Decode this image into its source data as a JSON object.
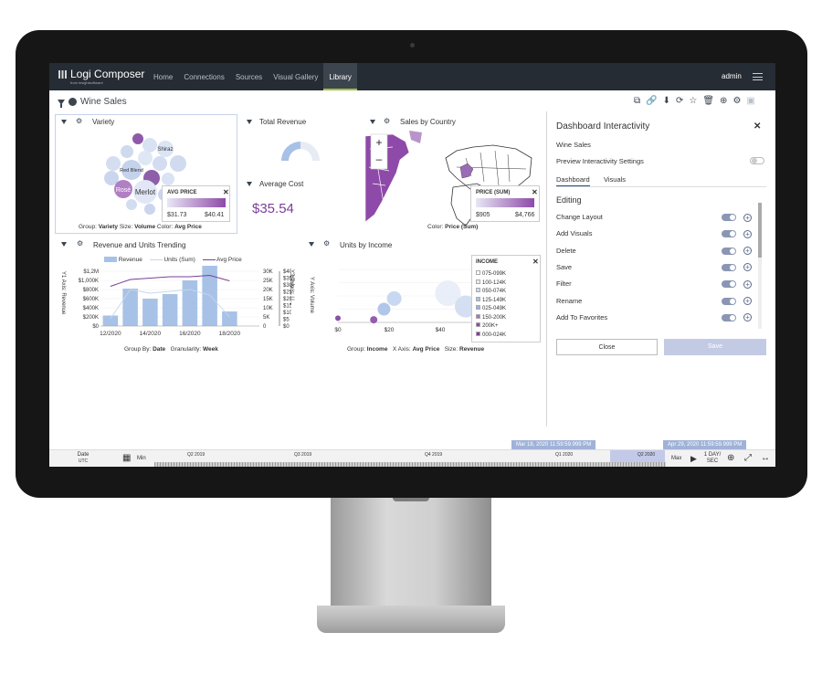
{
  "app": {
    "logo_name": "Logi Composer",
    "logo_sub": "from insightsoftware",
    "nav": [
      "Home",
      "Connections",
      "Sources",
      "Visual Gallery",
      "Library"
    ],
    "active_nav": "Library",
    "user": "admin"
  },
  "dashboard": {
    "title": "Wine Sales"
  },
  "variety": {
    "title": "Variety",
    "bubbles": [
      {
        "label": "Shiraz"
      },
      {
        "label": "Red Blend"
      },
      {
        "label": "Merlot"
      },
      {
        "label": "Rosé"
      }
    ],
    "legend_title": "AVG PRICE",
    "legend_min": "$31.73",
    "legend_max": "$40.41",
    "footer": {
      "group_label": "Group:",
      "group_value": "Variety",
      "size_label": "Size:",
      "size_value": "Volume",
      "color_label": "Color:",
      "color_value": "Avg Price"
    }
  },
  "total_revenue": {
    "title": "Total Revenue"
  },
  "average_cost": {
    "title": "Average Cost",
    "value": "$35.54"
  },
  "sales_by_country": {
    "title": "Sales by Country",
    "legend_title": "PRICE (SUM)",
    "legend_min": "$905",
    "legend_max": "$4,766",
    "footer": {
      "label": "Color:",
      "value": "Price (Sum)"
    }
  },
  "revenue_trend": {
    "title": "Revenue and Units Trending",
    "legend": [
      "Revenue",
      "Units (Sum)",
      "Avg Price"
    ],
    "y1_label": "Y1 Axis: Revenue",
    "y2_label": "Y2 Axis: U...",
    "y3_label": "Y3 Axis: ...",
    "footer": {
      "group_label": "Group By:",
      "group_value": "Date",
      "gran_label": "Granularity:",
      "gran_value": "Week"
    }
  },
  "units_income": {
    "title": "Units by Income",
    "y_label": "Y Axis: Volume",
    "legend_title": "INCOME",
    "legend_items": [
      "075-099K",
      "100-124K",
      "050-074K",
      "125-149K",
      "025-049K",
      "150-200K",
      "200K+",
      "000-024K"
    ],
    "footer": {
      "group_label": "Group:",
      "group_value": "Income",
      "x_label": "X Axis:",
      "x_value": "Avg Price",
      "size_label": "Size:",
      "size_value": "Revenue"
    }
  },
  "chart_data": [
    {
      "type": "bar",
      "title": "Revenue and Units Trending",
      "categories": [
        "12/2020",
        "",
        "14/2020",
        "",
        "16/2020",
        "",
        "18/2020",
        ""
      ],
      "x_tick_labels": [
        "12/2020",
        "14/2020",
        "16/2020",
        "18/2020"
      ],
      "series": [
        {
          "name": "Revenue",
          "type": "bar",
          "axis": "y1",
          "values": [
            230000,
            820000,
            600000,
            700000,
            1000000,
            1400000,
            320000,
            0
          ]
        },
        {
          "name": "Units (Sum)",
          "type": "line",
          "axis": "y2",
          "values": [
            4000,
            20000,
            18000,
            19000,
            20000,
            17000,
            5000,
            0
          ]
        },
        {
          "name": "Avg Price",
          "type": "line",
          "axis": "y3",
          "values": [
            29,
            34,
            35,
            36,
            36,
            37,
            33,
            0
          ]
        }
      ],
      "y1_ticks": [
        "$1,2M",
        "$1,000K",
        "$800K",
        "$600K",
        "$400K",
        "$200K",
        "$0"
      ],
      "y2_ticks": [
        "30K",
        "25K",
        "20K",
        "15K",
        "10K",
        "5K",
        "0"
      ],
      "y3_ticks": [
        "$40",
        "$35",
        "$30",
        "$25",
        "$20",
        "$15",
        "$10",
        "$5",
        "$0"
      ],
      "ylim": [
        0,
        1200000
      ]
    },
    {
      "type": "scatter",
      "title": "Units by Income",
      "x_ticks": [
        "$0",
        "$20",
        "$40",
        "$60"
      ],
      "xlim": [
        0,
        60
      ],
      "points": [
        {
          "series": "075-099K",
          "x": 43,
          "y": 0.55,
          "size": 14
        },
        {
          "series": "100-124K",
          "x": 50,
          "y": 0.3,
          "size": 12
        },
        {
          "series": "050-074K",
          "x": 22,
          "y": 0.45,
          "size": 8
        },
        {
          "series": "125-149K",
          "x": 18,
          "y": 0.25,
          "size": 7
        },
        {
          "series": "200K+",
          "x": 14,
          "y": 0.05,
          "size": 4
        },
        {
          "series": "000-024K",
          "x": 0,
          "y": 0.08,
          "size": 3
        }
      ]
    },
    {
      "type": "pie",
      "title": "Total Revenue",
      "values": [
        35,
        65
      ]
    }
  ],
  "colors": {
    "accent": "#8a96b4",
    "purple": "#7b3f98",
    "bar": "#a7c2e6",
    "nav_bg": "#262c33"
  },
  "interactivity": {
    "title": "Dashboard Interactivity",
    "dashboard_name": "Wine Sales",
    "preview_label": "Preview Interactivity Settings",
    "tabs": [
      "Dashboard",
      "Visuals"
    ],
    "section": "Editing",
    "items": [
      "Change Layout",
      "Add Visuals",
      "Delete",
      "Save",
      "Filter",
      "Rename",
      "Add To Favorites"
    ],
    "close_label": "Close",
    "save_label": "Save"
  },
  "timeline": {
    "date_label": "Date",
    "tz": "UTC",
    "min_label": "Min",
    "quarters": [
      "Q2 2019",
      "Q3 2019",
      "Q4 2019",
      "Q1 2020",
      "Q2 2020"
    ],
    "max_label": "Max",
    "speed": "1 DAY/\nSEC",
    "start_chip": "Mar 18, 2020 11:59:59.999 PM",
    "end_chip": "Apr 29, 2020 11:59:59.999 PM"
  }
}
